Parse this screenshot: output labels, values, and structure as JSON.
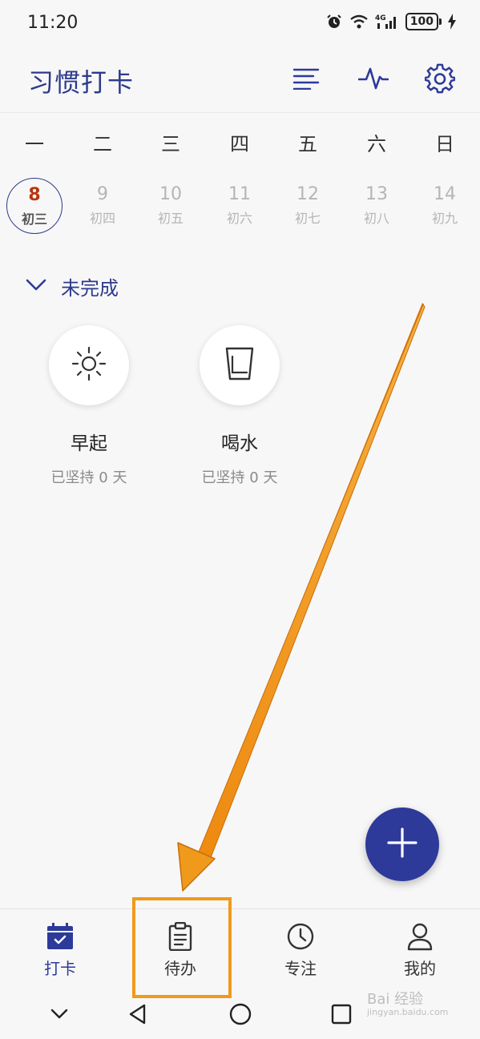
{
  "status_bar": {
    "time": "11:20",
    "network": "4G",
    "battery": "100"
  },
  "app_bar": {
    "title": "习惯打卡",
    "icons": [
      "list-icon",
      "activity-pulse-icon",
      "settings-gear-icon"
    ]
  },
  "calendar": {
    "weekdays": [
      "一",
      "二",
      "三",
      "四",
      "五",
      "六",
      "日"
    ],
    "days": [
      {
        "num": "8",
        "lunar": "初三",
        "selected": true
      },
      {
        "num": "9",
        "lunar": "初四",
        "selected": false
      },
      {
        "num": "10",
        "lunar": "初五",
        "selected": false
      },
      {
        "num": "11",
        "lunar": "初六",
        "selected": false
      },
      {
        "num": "12",
        "lunar": "初七",
        "selected": false
      },
      {
        "num": "13",
        "lunar": "初八",
        "selected": false
      },
      {
        "num": "14",
        "lunar": "初九",
        "selected": false
      }
    ]
  },
  "section": {
    "title": "未完成"
  },
  "habits": [
    {
      "name": "早起",
      "stat": "已坚持 0 天",
      "icon": "sun-icon"
    },
    {
      "name": "喝水",
      "stat": "已坚持 0 天",
      "icon": "water-glass-icon"
    }
  ],
  "fab": {
    "icon": "plus-icon"
  },
  "bottom_nav": [
    {
      "label": "打卡",
      "icon": "calendar-check-icon",
      "active": true
    },
    {
      "label": "待办",
      "icon": "clipboard-icon",
      "active": false
    },
    {
      "label": "专注",
      "icon": "clock-icon",
      "active": false
    },
    {
      "label": "我的",
      "icon": "person-icon",
      "active": false
    }
  ],
  "watermark": {
    "line1": "Bai 经验",
    "line2": "jingyan.baidu.com"
  },
  "colors": {
    "accent": "#2d3a9a",
    "selected_day": "#b8350f",
    "annotation": "#f09a1c"
  }
}
